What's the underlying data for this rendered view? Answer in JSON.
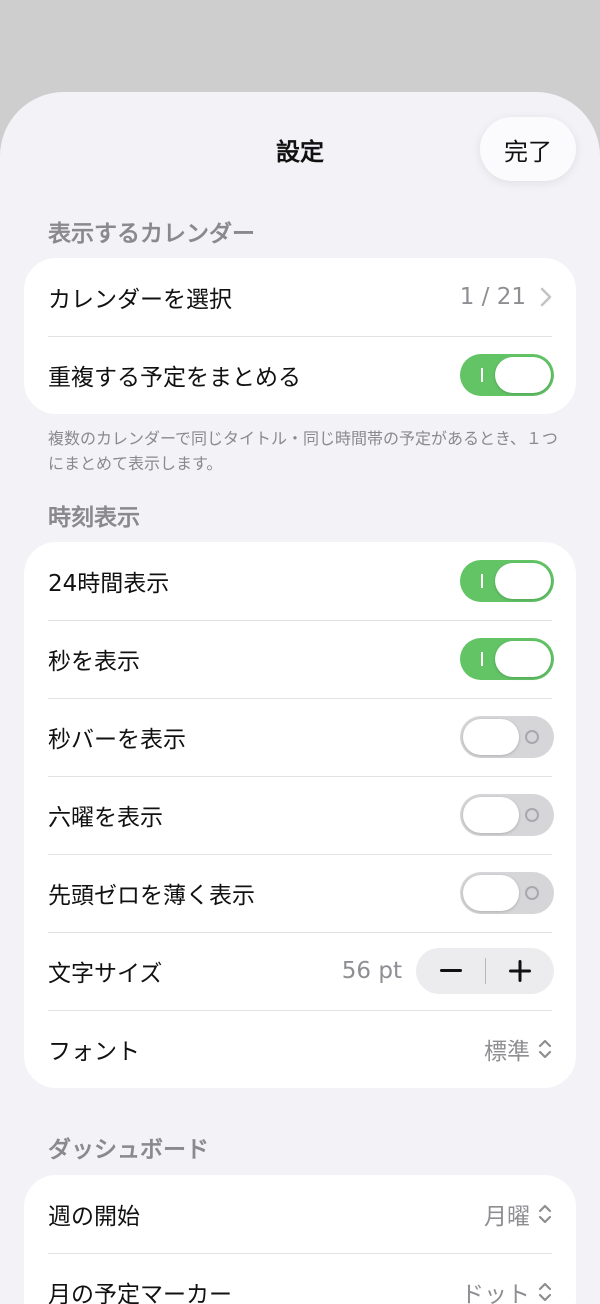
{
  "nav": {
    "title": "設定",
    "done_label": "完了"
  },
  "sections": {
    "calendar": {
      "header": "表示するカレンダー",
      "select_label": "カレンダーを選択",
      "select_value": "1 / 21",
      "merge_label": "重複する予定をまとめる",
      "merge_on": true,
      "footnote": "複数のカレンダーで同じタイトル・同じ時間帯の予定があるとき、１つにまとめて表示します。"
    },
    "time": {
      "header": "時刻表示",
      "hour24_label": "24時間表示",
      "seconds_label": "秒を表示",
      "seconds_bar_label": "秒バーを表示",
      "rokuyo_label": "六曜を表示",
      "leading_zero_label": "先頭ゼロを薄く表示",
      "font_size_label": "文字サイズ",
      "font_size_value": "56 pt",
      "stepper_minus": "−",
      "stepper_plus": "+",
      "font_label": "フォント",
      "font_value": "標準"
    },
    "dashboard": {
      "header": "ダッシュボード",
      "week_start_label": "週の開始",
      "week_start_value": "月曜",
      "marker_label": "月の予定マーカー",
      "marker_value": "ドット"
    }
  },
  "toggles": {
    "merge": true,
    "hour24": true,
    "seconds": true,
    "seconds_bar": false,
    "rokuyo": false,
    "leading_zero": false
  },
  "colors": {
    "toggle_on": "#63c466",
    "toggle_off": "#d6d6d8",
    "background": "#f2f2f7",
    "secondary_text": "#8e8e93"
  }
}
